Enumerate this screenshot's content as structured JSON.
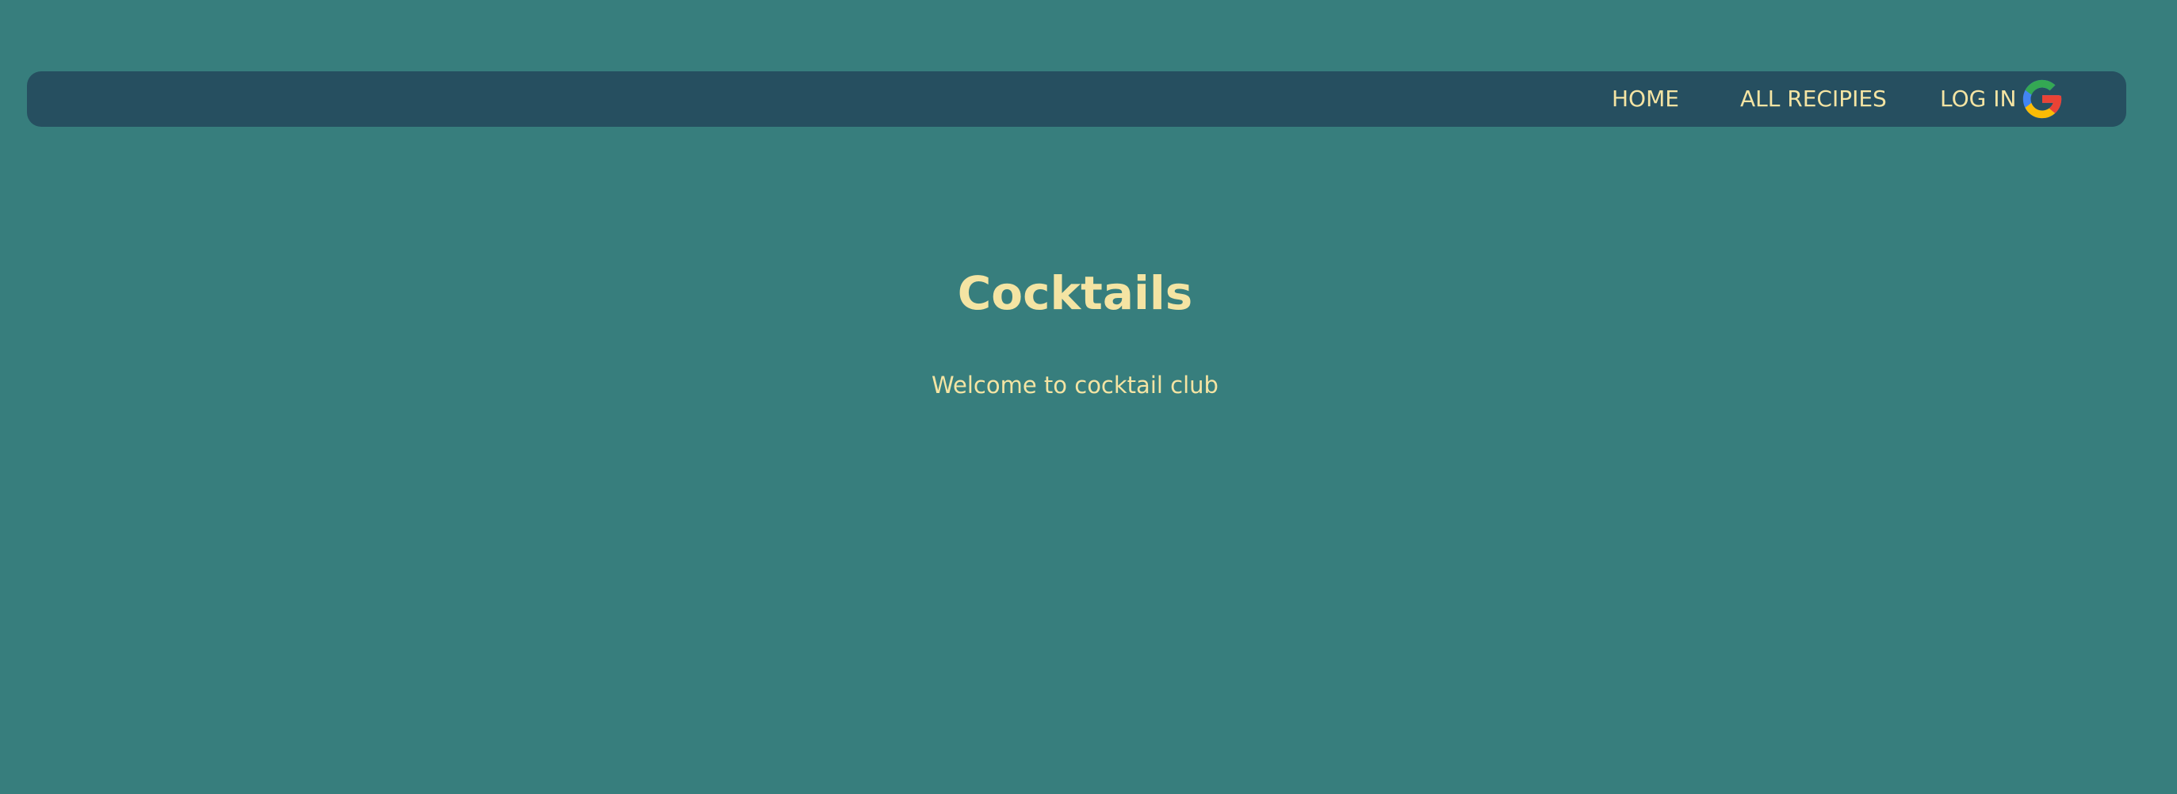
{
  "nav": {
    "home": "HOME",
    "all_recipes": "ALL RECIPIES",
    "login": "LOG IN",
    "login_icon": "google-icon"
  },
  "hero": {
    "title": "Cocktails",
    "subtitle": "Welcome to cocktail club"
  },
  "colors": {
    "background": "#377e7d",
    "navbar": "#264f60",
    "text": "#f4e4a3"
  }
}
